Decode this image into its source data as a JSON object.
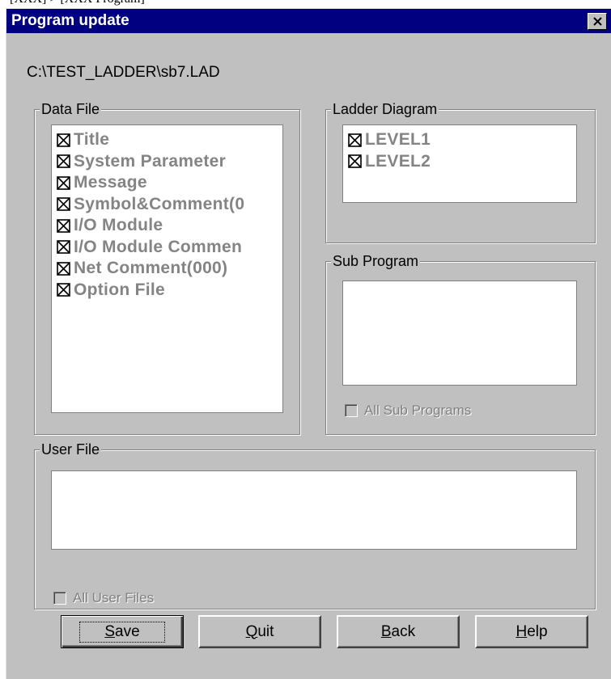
{
  "dialog": {
    "title": "Program update",
    "path": "C:\\TEST_LADDER\\sb7.LAD"
  },
  "data_file": {
    "label": "Data File",
    "items": [
      {
        "label": "Title",
        "checked": true
      },
      {
        "label": "System Parameter",
        "checked": true
      },
      {
        "label": "Message",
        "checked": true
      },
      {
        "label": "Symbol&Comment(0",
        "checked": true
      },
      {
        "label": "I/O Module",
        "checked": true
      },
      {
        "label": "I/O Module Commen",
        "checked": true
      },
      {
        "label": "Net Comment(000)",
        "checked": true
      },
      {
        "label": "Option File",
        "checked": true
      }
    ]
  },
  "ladder_diagram": {
    "label": "Ladder Diagram",
    "items": [
      {
        "label": "LEVEL1",
        "checked": true
      },
      {
        "label": "LEVEL2",
        "checked": true
      }
    ]
  },
  "sub_program": {
    "label": "Sub Program",
    "all_label": "All Sub Programs",
    "all_checked": false
  },
  "user_file": {
    "label": "User File",
    "all_label": "All User Files",
    "all_checked": false
  },
  "buttons": {
    "save": {
      "pre": "",
      "key": "S",
      "post": "ave"
    },
    "quit": {
      "pre": "",
      "key": "Q",
      "post": "uit"
    },
    "back": {
      "pre": "",
      "key": "B",
      "post": "ack"
    },
    "help": {
      "pre": "",
      "key": "H",
      "post": "elp"
    }
  },
  "icons": {
    "close": "close-icon",
    "checked_box": "checked-box-icon"
  },
  "colors": {
    "titlebar": "#000080",
    "face": "#c0c0c0",
    "disabled_text": "#848484"
  }
}
